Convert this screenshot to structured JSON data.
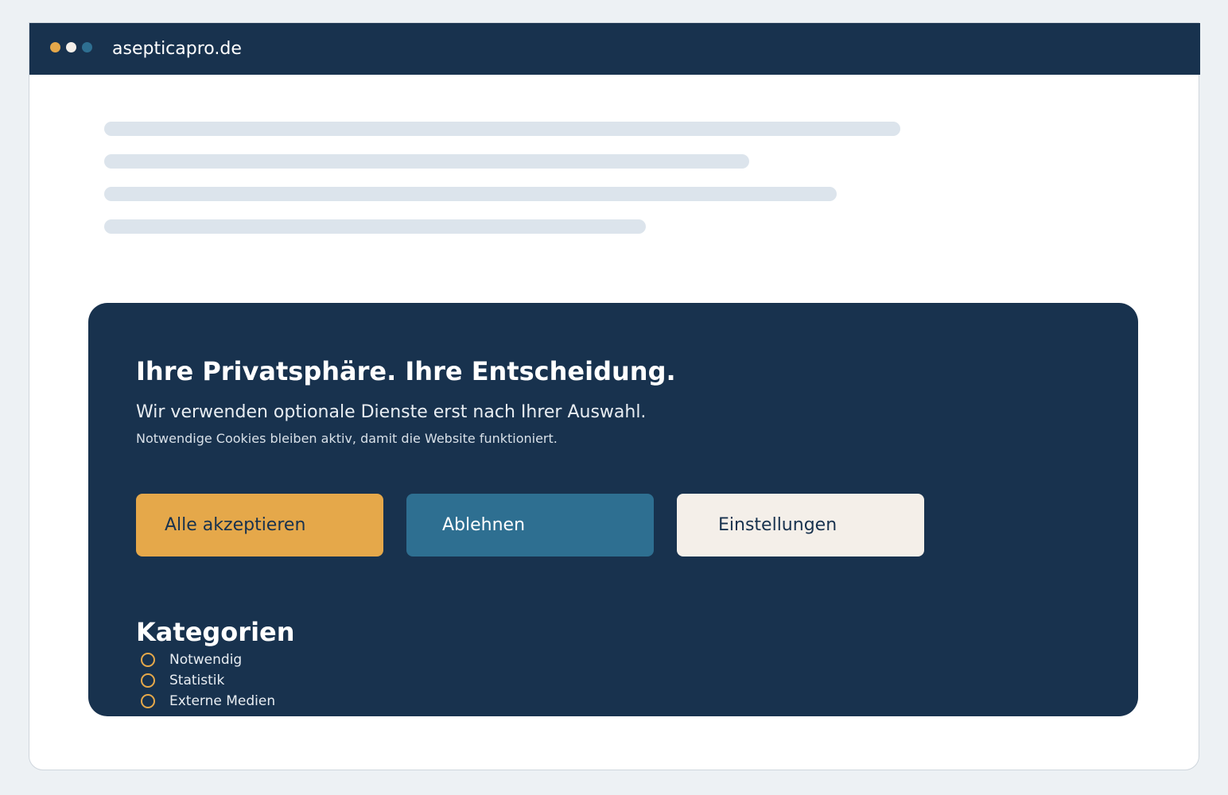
{
  "browser": {
    "url": "asepticapro.de",
    "traffic_lights": [
      "#e5a84a",
      "#f4efe9",
      "#2e6f91"
    ]
  },
  "colors": {
    "page_background": "#edf1f4",
    "titlebar": "#18324e",
    "skeleton": "#dce4ec",
    "banner": "#18324e",
    "accept": "#e5a84a",
    "reject": "#2e6f91",
    "settings": "#f4efe9"
  },
  "consent": {
    "title": "Ihre Privatsphäre. Ihre Entscheidung.",
    "lead": "Wir verwenden optionale Dienste erst nach Ihrer Auswahl.",
    "note": "Notwendige Cookies bleiben aktiv, damit die Website funktioniert.",
    "buttons": {
      "accept": "Alle akzeptieren",
      "reject": "Ablehnen",
      "settings": "Einstellungen"
    },
    "categories_title": "Kategorien",
    "categories": [
      "Notwendig",
      "Statistik",
      "Externe Medien"
    ]
  }
}
